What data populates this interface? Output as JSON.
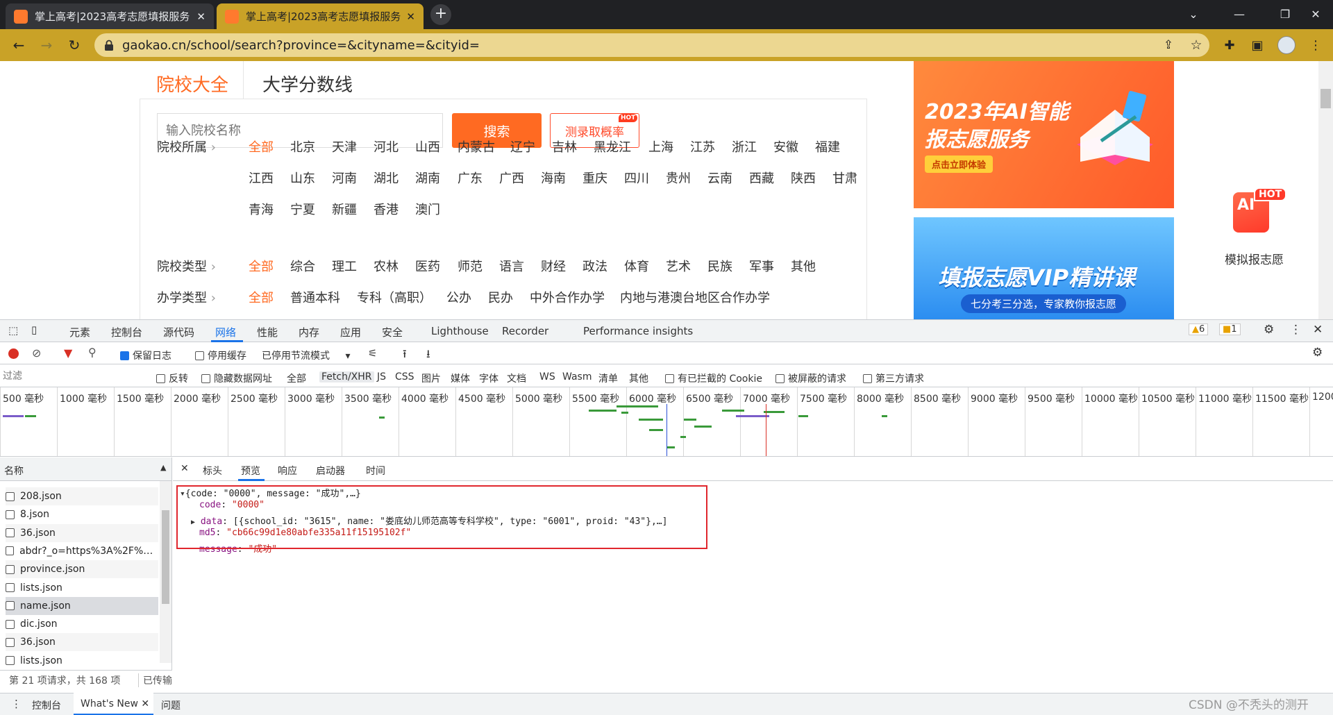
{
  "browser": {
    "tabs": [
      {
        "title": "掌上高考|2023高考志愿填报服务",
        "close": "✕"
      },
      {
        "title": "掌上高考|2023高考志愿填报服务",
        "close": "✕"
      }
    ],
    "new_tab": "+",
    "url": "gaokao.cn/school/search?province=&cityname=&cityid="
  },
  "page": {
    "tabs": [
      "院校大全",
      "大学分数线"
    ],
    "search_placeholder": "输入院校名称",
    "search_button": "搜索",
    "probability_button": "测录取概率",
    "hot_badge": "HOT",
    "filters": {
      "region_label": "院校所属",
      "region_options": [
        "全部",
        "北京",
        "天津",
        "河北",
        "山西",
        "内蒙古",
        "辽宁",
        "吉林",
        "黑龙江",
        "上海",
        "江苏",
        "浙江",
        "安徽",
        "福建",
        "江西",
        "山东",
        "河南",
        "湖北",
        "湖南",
        "广东",
        "广西",
        "海南",
        "重庆",
        "四川",
        "贵州",
        "云南",
        "西藏",
        "陕西",
        "甘肃",
        "青海",
        "宁夏",
        "新疆",
        "香港",
        "澳门"
      ],
      "type_label": "院校类型",
      "type_options": [
        "全部",
        "综合",
        "理工",
        "农林",
        "医药",
        "师范",
        "语言",
        "财经",
        "政法",
        "体育",
        "艺术",
        "民族",
        "军事",
        "其他"
      ],
      "level_label": "办学类型",
      "level_options": [
        "全部",
        "普通本科",
        "专科（高职）",
        "公办",
        "民办",
        "中外合作办学",
        "内地与港澳台地区合作办学"
      ]
    },
    "banners": {
      "ai_title_line1": "2023年AI智能",
      "ai_title_line2": "报志愿服务",
      "ai_cta": "点击立即体验",
      "vip_title": "填报志愿VIP精讲课",
      "vip_subtitle": "七分考三分选，专家教你报志愿"
    },
    "side_widget": {
      "label": "模拟报志愿",
      "badge": "HOT",
      "icon_text": "AI"
    }
  },
  "devtools": {
    "tabs": [
      "元素",
      "控制台",
      "源代码",
      "网络",
      "性能",
      "内存",
      "应用",
      "安全",
      "Lighthouse",
      "Recorder",
      "Performance insights"
    ],
    "active_tab": "网络",
    "warnings": "6",
    "issues": "1",
    "toolbar": {
      "preserve_log": "保留日志",
      "disable_cache": "停用缓存",
      "throttling": "已停用节流模式"
    },
    "filter_bar": {
      "placeholder": "过滤",
      "invert": "反转",
      "hide_data_urls": "隐藏数据网址",
      "types": [
        "全部",
        "Fetch/XHR",
        "JS",
        "CSS",
        "图片",
        "媒体",
        "字体",
        "文档",
        "WS",
        "Wasm",
        "清单",
        "其他"
      ],
      "active_type": "Fetch/XHR",
      "blocked_cookies": "有已拦截的 Cookie",
      "blocked_requests": "被屏蔽的请求",
      "third_party": "第三方请求"
    },
    "timeline_ticks": [
      "500 毫秒",
      "1000 毫秒",
      "1500 毫秒",
      "2000 毫秒",
      "2500 毫秒",
      "3000 毫秒",
      "3500 毫秒",
      "4000 毫秒",
      "4500 毫秒",
      "5000 毫秒",
      "5500 毫秒",
      "6000 毫秒",
      "6500 毫秒",
      "7000 毫秒",
      "7500 毫秒",
      "8000 毫秒",
      "8500 毫秒",
      "9000 毫秒",
      "9500 毫秒",
      "10000 毫秒",
      "10500 毫秒",
      "11000 毫秒",
      "11500 毫秒",
      "1200"
    ],
    "requests": {
      "header": "名称",
      "items": [
        "208.json",
        "8.json",
        "36.json",
        "abdr?_o=https%3A%2F%2Fw...",
        "province.json",
        "lists.json",
        "name.json",
        "dic.json",
        "36.json",
        "lists.json"
      ],
      "selected": "name.json",
      "status": "第 21 项请求，共 168 项",
      "transferred": "已传输"
    },
    "detail_tabs": [
      "标头",
      "预览",
      "响应",
      "启动器",
      "时间"
    ],
    "active_detail_tab": "预览",
    "preview": {
      "summary": "{code: \"0000\", message: \"成功\",…}",
      "code_key": "code",
      "code_val": "\"0000\"",
      "data_key": "data",
      "data_val": "[{school_id: \"3615\", name: \"娄底幼儿师范高等专科学校\", type: \"6001\", proid: \"43\"},…]",
      "md5_key": "md5",
      "md5_val": "\"cb66c99d1e80abfe335a11f15195102f\"",
      "message_key": "message",
      "message_val": "\"成功\""
    },
    "drawer_tabs": [
      "控制台",
      "What's New",
      "问题"
    ],
    "watermark": "CSDN @不秃头的测开"
  },
  "colors": {
    "accent": "#ff6a22",
    "toolbar": "#c9a227",
    "highlight_box": "#e0262d"
  }
}
